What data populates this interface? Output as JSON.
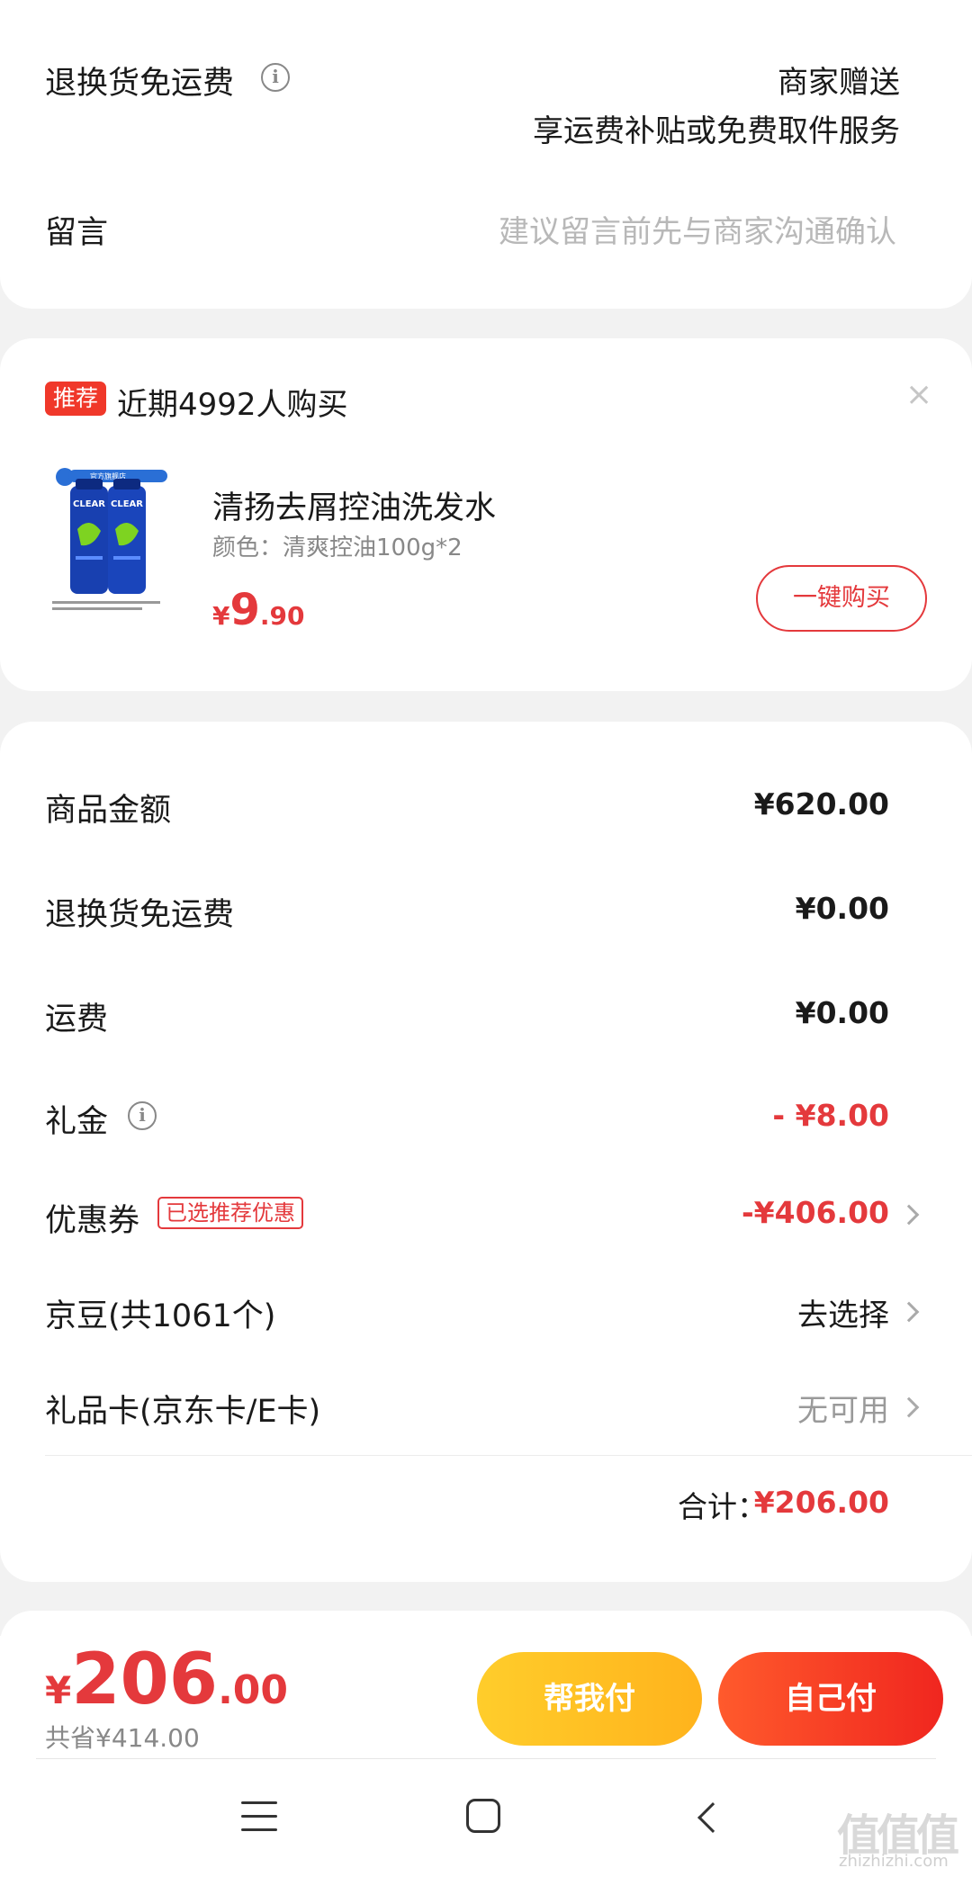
{
  "top_section": {
    "return_shipping_label": "退换货免运费",
    "gift_line1": "商家赠送",
    "gift_line2": "享运费补贴或免费取件服务",
    "message_label": "留言",
    "message_placeholder": "建议留言前先与商家沟通确认"
  },
  "recommendation": {
    "tag": "推荐",
    "title": "近期4992人购买",
    "close_icon": "×",
    "product": {
      "name": "清扬去屑控油洗发水",
      "spec": "颜色：清爽控油100g*2",
      "price_symbol": "¥",
      "price_int": "9",
      "price_dec": ".90",
      "image_brand": "CLEAR",
      "image_badge": "官方旗舰店"
    },
    "buy_button": "一键购买"
  },
  "summary": {
    "rows": [
      {
        "label": "商品金额",
        "value": "¥620.00"
      },
      {
        "label": "退换货免运费",
        "value": "¥0.00"
      },
      {
        "label": "运费",
        "value": "¥0.00"
      },
      {
        "label": "礼金",
        "value": "- ¥8.00"
      },
      {
        "label": "优惠券",
        "value": "-¥406.00",
        "badge": "已选推荐优惠"
      },
      {
        "label": "京豆(共1061个)",
        "value": "去选择"
      },
      {
        "label": "礼品卡(京东卡/E卡)",
        "value": "无可用"
      }
    ],
    "total_label": "合计：",
    "total_value": "¥206.00"
  },
  "bottom_bar": {
    "pay_symbol": "¥",
    "pay_int": "206",
    "pay_dec": ".00",
    "saved": "共省¥414.00",
    "help_pay_button": "帮我付",
    "self_pay_button": "自己付"
  },
  "watermark": {
    "main": "值值值",
    "sub": "zhizhizhi.com"
  },
  "colors": {
    "accent_red": "#e4393c",
    "help_pay_yellow": "#ffbf22",
    "self_pay_red": "#f23a22"
  }
}
